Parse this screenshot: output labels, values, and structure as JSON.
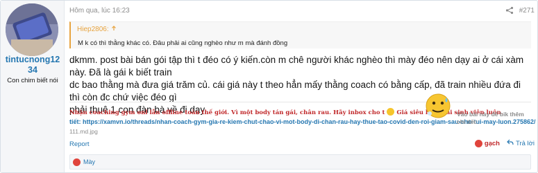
{
  "user": {
    "name": "tintucnong1234",
    "title": "Con chim biết nói"
  },
  "post": {
    "time": "Hôm qua, lúc 16:23",
    "number": "#271",
    "quote": {
      "author": "Hiep2806:",
      "text": "M k có thì thằng khác có. Đâu phải ai cũng nghèo như m mà đánh đồng"
    },
    "body_lines": [
      "dkmm. post bài bán gói tập thì t đéo có ý kiến.còn m chê người khác nghèo thì mày đéo nên dạy ai ở cái xàm này. Đã là gái k biết train",
      "dc bao thằng mà đưa giá trăm củ. cái giá này t theo hẳn mấy thằng coach có bằng cấp, đã train nhiều đứa đi thì còn đc chứ việc đéo gì",
      "phải thuê 1 con đàn bà về đi dạy."
    ]
  },
  "signature": {
    "line1": "Nhận coaching gym onl lẫn offline toàn thế giới. Vì một body tán gái, chân rau. Hãy inbox cho t",
    "line1_tail": "Giá siêu hậu mãi sinh viên luôn.",
    "link": "tiết: https://xamvn.io/threads/nhan-coach-gym-gia-re-kiem-chut-chao-vi-mot-body-di-chan-rau-hay-thue-tao-covid-den-roi-giam-sau-cho-tui-may-luon.275862/",
    "link2": "111.md.jpg",
    "right_text": "Vào bài này để bik thêm chi tiết:"
  },
  "actions": {
    "report": "Report",
    "react": "gạch",
    "reply": "Trả lời"
  },
  "reactions": {
    "label": "Mày"
  },
  "colors": {
    "link": "#2577b1",
    "quote_accent": "#e7a33e",
    "signature_red": "#c0292b"
  }
}
